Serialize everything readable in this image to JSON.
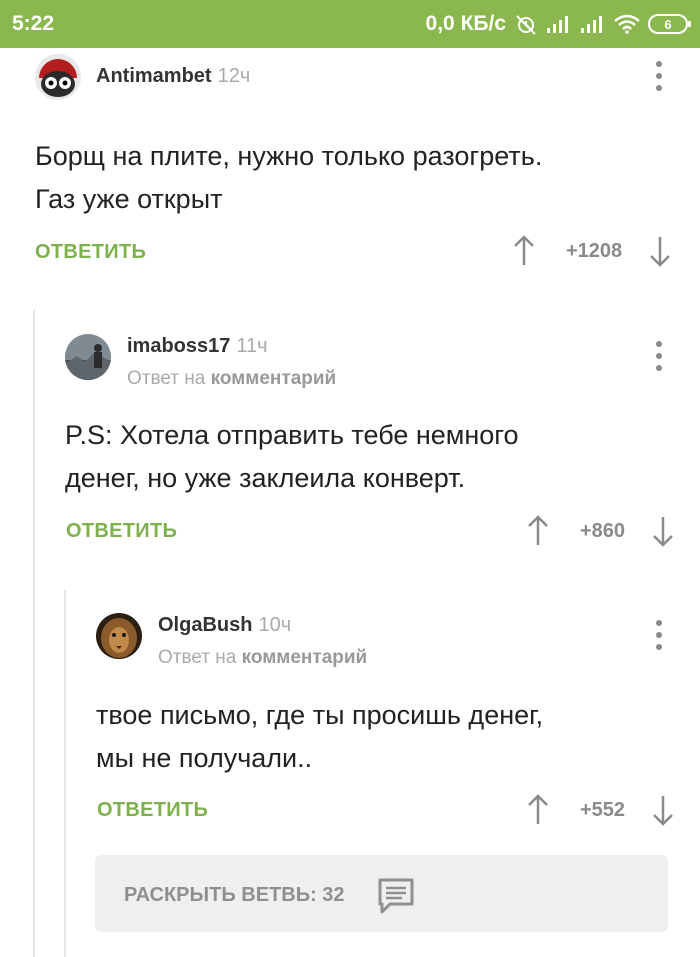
{
  "status_bar": {
    "time": "5:22",
    "network_speed": "0,0 КБ/с",
    "battery_level": "6",
    "icons": [
      "alarm-off-icon",
      "signal-icon",
      "signal-icon",
      "wifi-icon",
      "battery-icon"
    ]
  },
  "comments": [
    {
      "author": "Antimambet",
      "time": "12ч",
      "reply_to": null,
      "text_lines": [
        "Борщ на плите, нужно только разогреть.",
        "Газ уже открыт"
      ],
      "reply_label": "ОТВЕТИТЬ",
      "score": "+1208"
    },
    {
      "author": "imaboss17",
      "time": "11ч",
      "reply_prefix": "Ответ на",
      "reply_target": "комментарий",
      "text_lines": [
        "P.S: Хотела отправить тебе немного",
        "денег, но уже заклеила конверт."
      ],
      "reply_label": "ОТВЕТИТЬ",
      "score": "+860"
    },
    {
      "author": "OlgaBush",
      "time": "10ч",
      "reply_prefix": "Ответ на",
      "reply_target": "комментарий",
      "text_lines": [
        "твое письмо, где ты просишь денег,",
        "мы не получали.."
      ],
      "reply_label": "ОТВЕТИТЬ",
      "score": "+552"
    }
  ],
  "expand_branch": {
    "label": "РАСКРЫТЬ ВЕТВЬ: 32",
    "icon": "comment-icon"
  },
  "colors": {
    "status_bar": "#8ab84f",
    "accent_green": "#7fb04e"
  }
}
